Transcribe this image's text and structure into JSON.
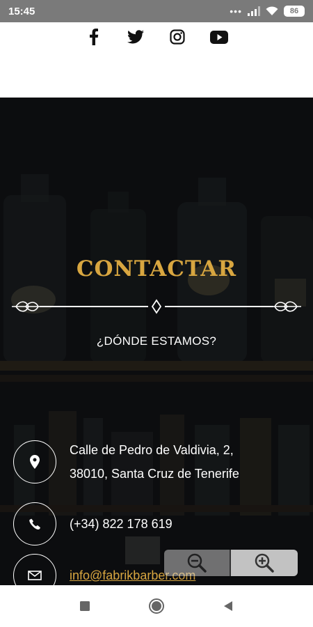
{
  "status_bar": {
    "time": "15:45",
    "battery": "86",
    "icons": [
      "dots-icon",
      "signal-icon",
      "wifi-icon",
      "battery-icon"
    ]
  },
  "social": {
    "icons": [
      "facebook-icon",
      "twitter-icon",
      "instagram-icon",
      "youtube-icon"
    ]
  },
  "section": {
    "title": "CONTACTAR",
    "subtitle": "¿DÓNDE ESTAMOS?"
  },
  "contact": {
    "address_line1": "Calle de Pedro de Valdivia, 2,",
    "address_line2": "38010, Santa Cruz de Tenerife",
    "phone": "(+34) 822 178 619",
    "email": "info@fabrikbarber.com"
  },
  "zoom": {
    "icons": [
      "zoom-out-icon",
      "zoom-in-icon"
    ]
  },
  "nav": {
    "icons": [
      "recents-icon",
      "home-icon",
      "back-icon"
    ]
  },
  "colors": {
    "accent": "#d8a640",
    "background": "#15181b",
    "statusbar": "#7a7a7a"
  }
}
